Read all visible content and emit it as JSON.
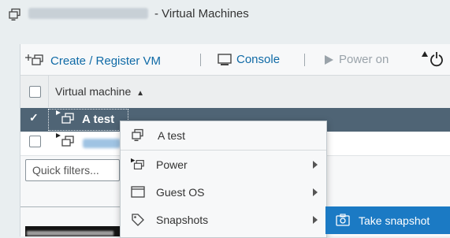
{
  "window": {
    "title_suffix": "- Virtual Machines",
    "icon": "vm-stack-icon"
  },
  "toolbar": {
    "create_label": "Create / Register VM",
    "console_label": "Console",
    "power_on_label": "Power on",
    "separator": "|",
    "icons": [
      "add-vm-icon",
      "console-icon",
      "play-icon",
      "power-icon"
    ]
  },
  "grid": {
    "column_header": "Virtual machine",
    "sort_indicator": "▲",
    "rows": [
      {
        "name": "A test",
        "selected": true,
        "checked": true
      },
      {
        "name": "",
        "selected": false,
        "checked": false
      }
    ],
    "check_mark": "✓"
  },
  "quick_filters": {
    "placeholder": "Quick filters..."
  },
  "context_menu": {
    "header": "A test",
    "items": [
      {
        "label": "Power",
        "icon": "vm-stack-icon",
        "has_submenu": true
      },
      {
        "label": "Guest OS",
        "icon": "window-icon",
        "has_submenu": true
      },
      {
        "label": "Snapshots",
        "icon": "tag-icon",
        "has_submenu": true
      }
    ]
  },
  "submenu": {
    "take_snapshot_label": "Take snapshot",
    "icon": "camera-icon"
  },
  "colors": {
    "link": "#0f6aa6",
    "selected_row": "#4f6475",
    "submenu_highlight": "#1b7ac4"
  }
}
